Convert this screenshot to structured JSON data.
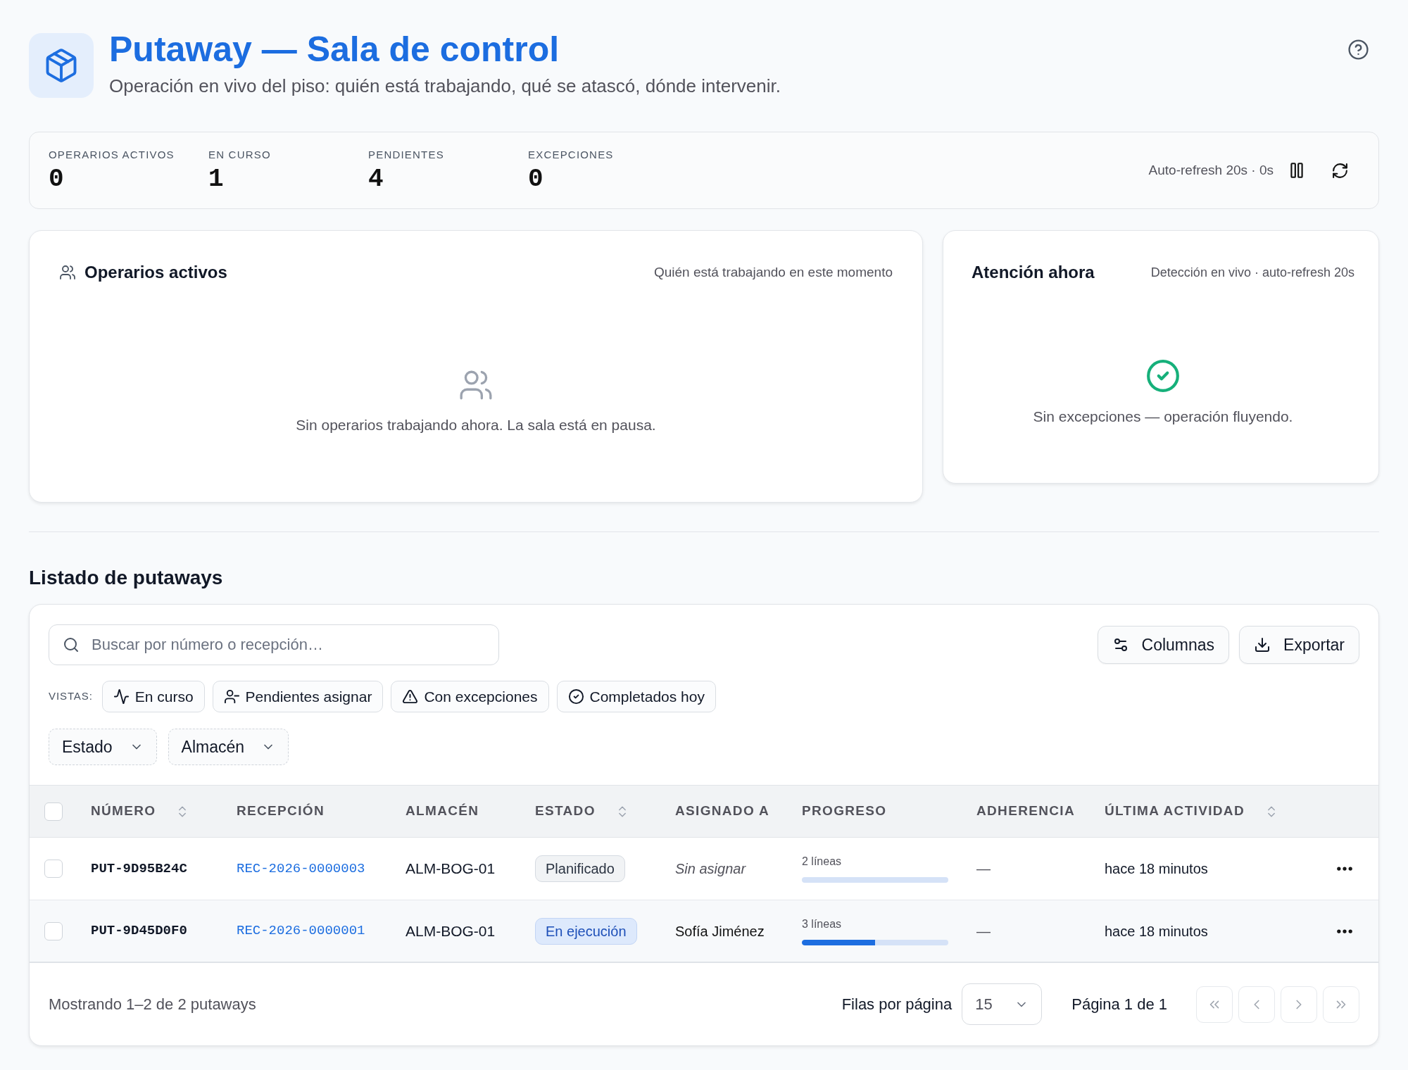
{
  "header": {
    "title": "Putaway — Sala de control",
    "subtitle": "Operación en vivo del piso: quién está trabajando, qué se atascó, dónde intervenir."
  },
  "stats": [
    {
      "label": "OPERARIOS ACTIVOS",
      "value": "0"
    },
    {
      "label": "EN CURSO",
      "value": "1"
    },
    {
      "label": "PENDIENTES",
      "value": "4"
    },
    {
      "label": "EXCEPCIONES",
      "value": "0"
    }
  ],
  "auto_refresh": {
    "text": "Auto-refresh 20s · 0s"
  },
  "active_operators": {
    "title": "Operarios activos",
    "note": "Quién está trabajando en este momento",
    "empty_message": "Sin operarios trabajando ahora. La sala está en pausa."
  },
  "attention": {
    "title": "Atención ahora",
    "note": "Detección en vivo · auto-refresh 20s",
    "empty_message": "Sin excepciones — operación fluyendo."
  },
  "listing": {
    "title": "Listado de putaways",
    "search": {
      "placeholder": "Buscar por número o recepción…"
    },
    "actions": [
      {
        "label": "Columnas",
        "kind": "columns"
      },
      {
        "label": "Exportar",
        "kind": "export"
      }
    ],
    "views_label": "VISTAS:",
    "views": [
      {
        "label": "En curso",
        "kind": "activity",
        "selected": false
      },
      {
        "label": "Pendientes asignar",
        "kind": "unassigned",
        "selected": false
      },
      {
        "label": "Con excepciones",
        "kind": "warning",
        "selected": false
      },
      {
        "label": "Completados hoy",
        "kind": "done",
        "selected": false
      }
    ],
    "filters": [
      {
        "label": "Estado"
      },
      {
        "label": "Almacén"
      }
    ],
    "table": {
      "select_all_checked": false,
      "columns": [
        {
          "label": "NÚMERO",
          "sortable": true
        },
        {
          "label": "RECEPCIÓN",
          "sortable": false
        },
        {
          "label": "ALMACÉN",
          "sortable": false
        },
        {
          "label": "ESTADO",
          "sortable": true
        },
        {
          "label": "ASIGNADO A",
          "sortable": false
        },
        {
          "label": "PROGRESO",
          "sortable": false
        },
        {
          "label": "ADHERENCIA",
          "sortable": false
        },
        {
          "label": "ÚLTIMA ACTIVIDAD",
          "sortable": true
        }
      ],
      "rows": [
        {
          "checked": false,
          "highlighted": false,
          "number": "PUT-9D95B24C",
          "reception": "REC-2026-0000003",
          "warehouse": "ALM-BOG-01",
          "status": {
            "label": "Planificado",
            "kind": "planned"
          },
          "assignee": {
            "text": "Sin asignar",
            "unassigned": true
          },
          "progress": {
            "text": "2 líneas",
            "level": 0
          },
          "adherence": "—",
          "last_activity": "hace 18 minutos"
        },
        {
          "checked": false,
          "highlighted": true,
          "number": "PUT-9D45D0F0",
          "reception": "REC-2026-0000001",
          "warehouse": "ALM-BOG-01",
          "status": {
            "label": "En ejecución",
            "kind": "running"
          },
          "assignee": {
            "text": "Sofía Jiménez",
            "unassigned": false
          },
          "progress": {
            "text": "3 líneas",
            "level": 0.5
          },
          "adherence": "—",
          "last_activity": "hace 18 minutos"
        }
      ]
    },
    "footer": {
      "summary": "Mostrando 1–2 de 2 putaways",
      "rows_per_page_label": "Filas por página",
      "rows_per_page": "15",
      "page_text": "Página 1 de 1",
      "nav": [
        {
          "kind": "first",
          "disabled": true
        },
        {
          "kind": "previous",
          "disabled": true
        },
        {
          "kind": "next",
          "disabled": true
        },
        {
          "kind": "last",
          "disabled": true
        }
      ]
    }
  }
}
